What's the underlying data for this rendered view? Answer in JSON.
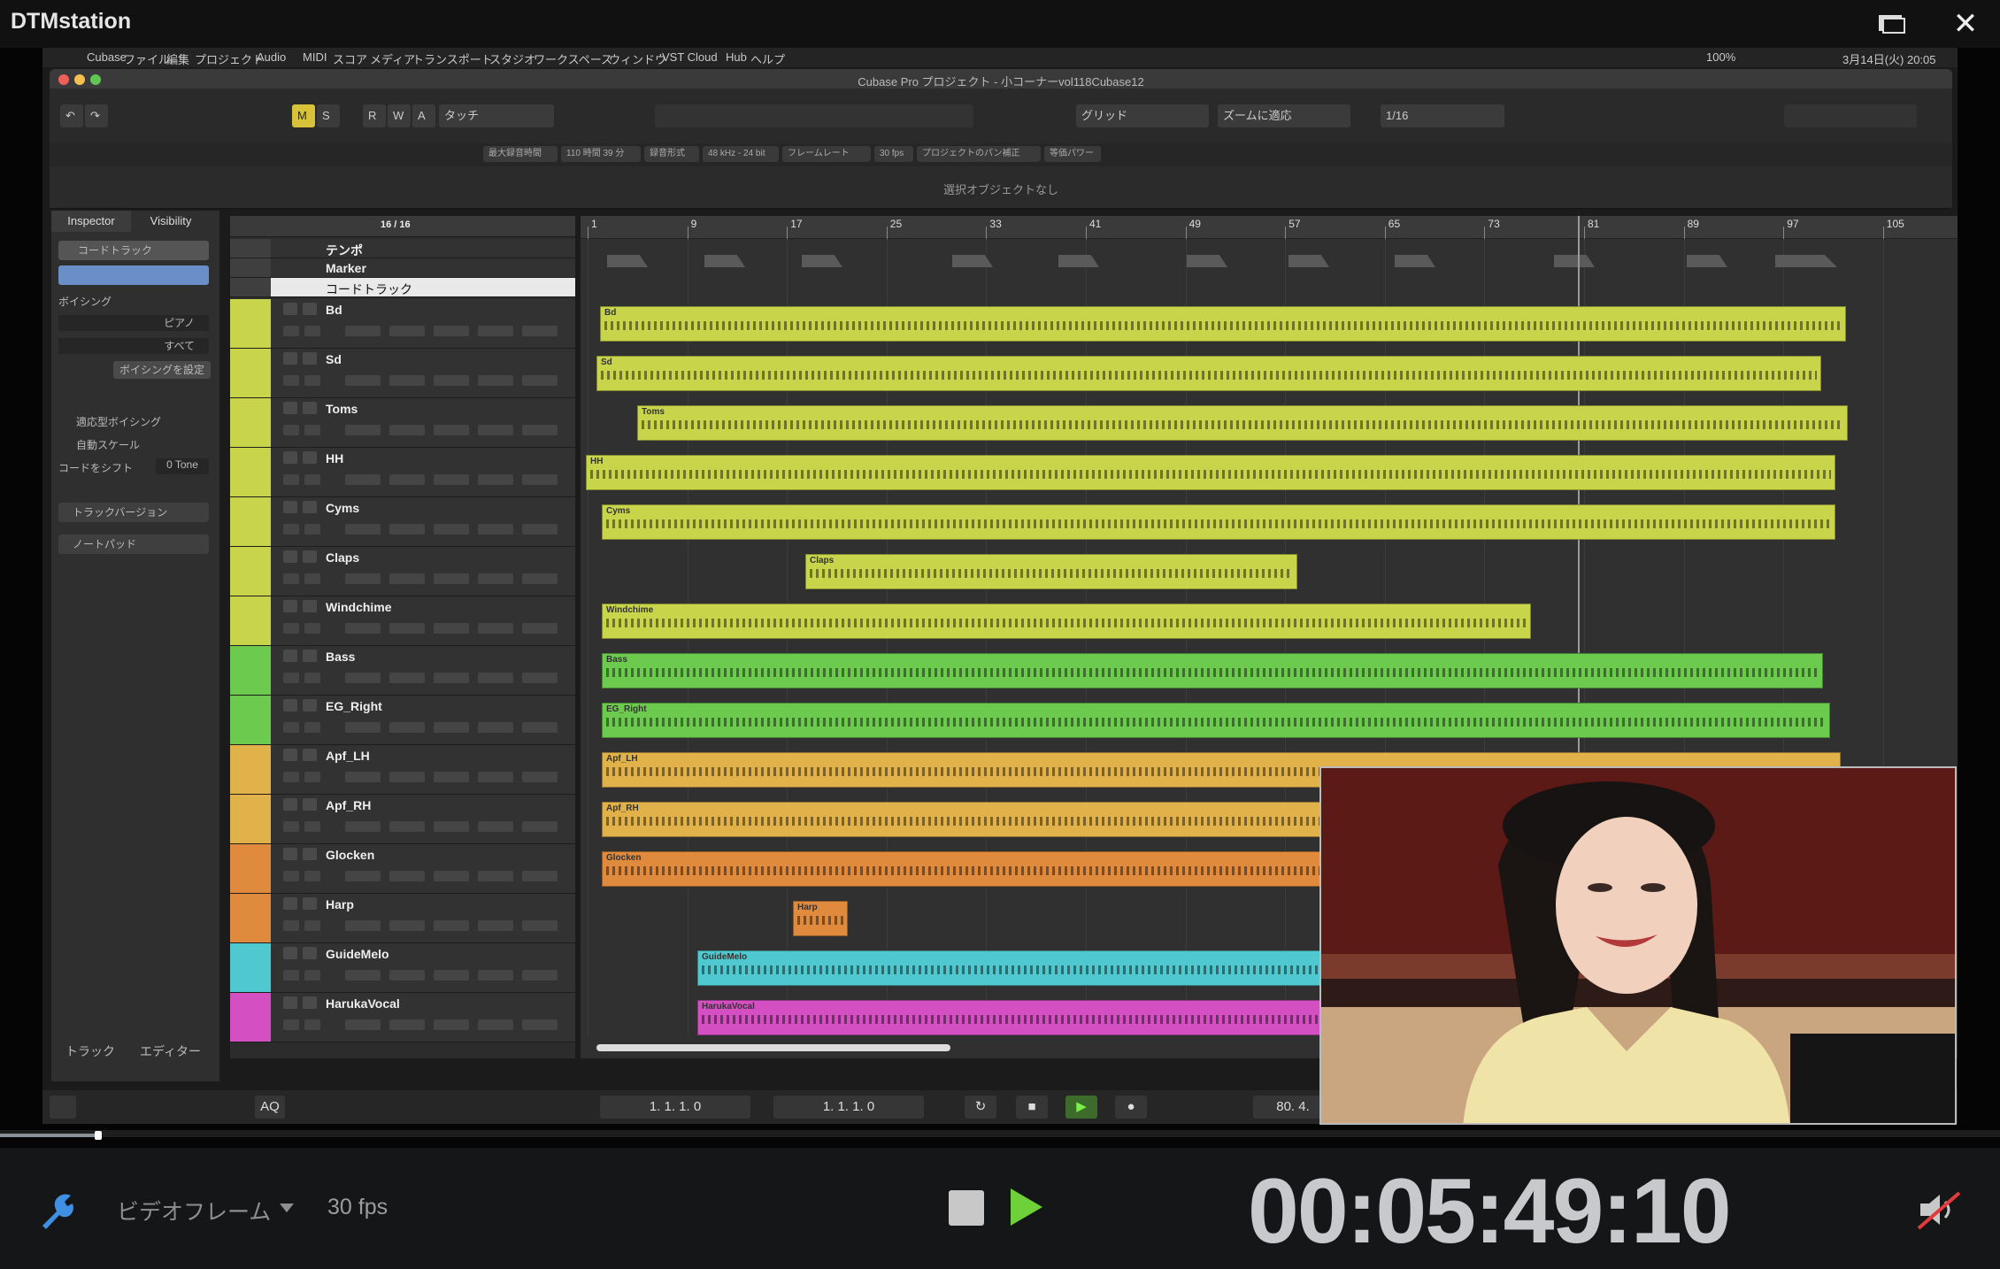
{
  "app": {
    "title": "DTMstation"
  },
  "mac_menu": {
    "items": [
      "Cubase",
      "ファイル",
      "編集",
      "プロジェクト",
      "Audio",
      "MIDI",
      "スコア",
      "メディア",
      "トランスポート",
      "スタジオ",
      "ワークスペース",
      "ウィンドウ",
      "VST Cloud",
      "Hub",
      "ヘルプ"
    ],
    "status": "100%",
    "clock": "3月14日(火) 20:05"
  },
  "window": {
    "doc_title": "Cubase Pro プロジェクト - 小コーナーvol118Cubase12"
  },
  "toolbar": {
    "automation_mode": "タッチ",
    "snap_type": "グリッド",
    "snap_mode": "ズームに適応",
    "quantize": "1/16"
  },
  "infobar": {
    "items": [
      "最大録音時間",
      "110 時間 39 分",
      "録音形式",
      "48 kHz - 24 bit",
      "フレームレート",
      "30 fps",
      "プロジェクトのパン補正",
      "等価パワー"
    ],
    "no_selection": "選択オブジェクトなし"
  },
  "inspector": {
    "tabs": [
      "Inspector",
      "Visibility"
    ],
    "section": "コードトラック",
    "voicing_label": "ボイシング",
    "voicing_value": "ピアノ",
    "sub_value": "すべて",
    "voicing_btn": "ボイシングを設定",
    "adaptive_voicing": "適応型ボイシング",
    "auto_scale": "自動スケール",
    "chord_shift": "コードをシフト",
    "chord_shift_value": "0 Tone",
    "track_versions": "トラックバージョン",
    "notepad": "ノートパッド",
    "bottom_tabs": [
      "トラック",
      "エディター"
    ]
  },
  "tracklist": {
    "header": "16 / 16",
    "global": [
      "テンポ",
      "Marker",
      "コードトラック"
    ],
    "tracks": [
      {
        "name": "Bd",
        "color": "#c8d54a"
      },
      {
        "name": "Sd",
        "color": "#c8d54a"
      },
      {
        "name": "Toms",
        "color": "#c8d54a"
      },
      {
        "name": "HH",
        "color": "#c8d54a"
      },
      {
        "name": "Cyms",
        "color": "#c8d54a"
      },
      {
        "name": "Claps",
        "color": "#c8d54a"
      },
      {
        "name": "Windchime",
        "color": "#c8d54a"
      },
      {
        "name": "Bass",
        "color": "#6ccb4e"
      },
      {
        "name": "EG_Right",
        "color": "#6ccb4e"
      },
      {
        "name": "Apf_LH",
        "color": "#e2b24a"
      },
      {
        "name": "Apf_RH",
        "color": "#e2b24a"
      },
      {
        "name": "Glocken",
        "color": "#e08a3d"
      },
      {
        "name": "Harp",
        "color": "#e08a3d"
      },
      {
        "name": "GuideMelo",
        "color": "#4fc9cf"
      },
      {
        "name": "HarukaVocal",
        "color": "#d44fc2"
      }
    ]
  },
  "ruler": {
    "bars": [
      "1",
      "9",
      "17",
      "25",
      "33",
      "41",
      "49",
      "57",
      "65",
      "73",
      "81",
      "89",
      "97",
      "105"
    ]
  },
  "arrange": {
    "parts": [
      {
        "row": 0,
        "label": "Bd"
      },
      {
        "row": 1,
        "label": "Sd"
      },
      {
        "row": 2,
        "label": "Toms"
      },
      {
        "row": 3,
        "label": "HH"
      },
      {
        "row": 4,
        "label": "Cyms"
      },
      {
        "row": 5,
        "label": "Claps"
      },
      {
        "row": 6,
        "label": "Windchime"
      },
      {
        "row": 7,
        "label": "Bass"
      },
      {
        "row": 8,
        "label": "EG_Right"
      },
      {
        "row": 9,
        "label": "Apf_LH"
      },
      {
        "row": 10,
        "label": "Apf_RH"
      },
      {
        "row": 11,
        "label": "Glocken"
      },
      {
        "row": 12,
        "label": "Harp"
      },
      {
        "row": 13,
        "label": "GuideMelo"
      },
      {
        "row": 14,
        "label": "HarukaVocal"
      }
    ]
  },
  "transport": {
    "left_locator": "1. 1. 1.   0",
    "right_locator": "1. 1. 1.   0",
    "aq": "AQ",
    "tempo": "80. 4."
  },
  "player": {
    "frame_mode": "ビデオフレーム",
    "fps": "30 fps",
    "timecode": "00:05:49:10",
    "progress": 0.034
  }
}
